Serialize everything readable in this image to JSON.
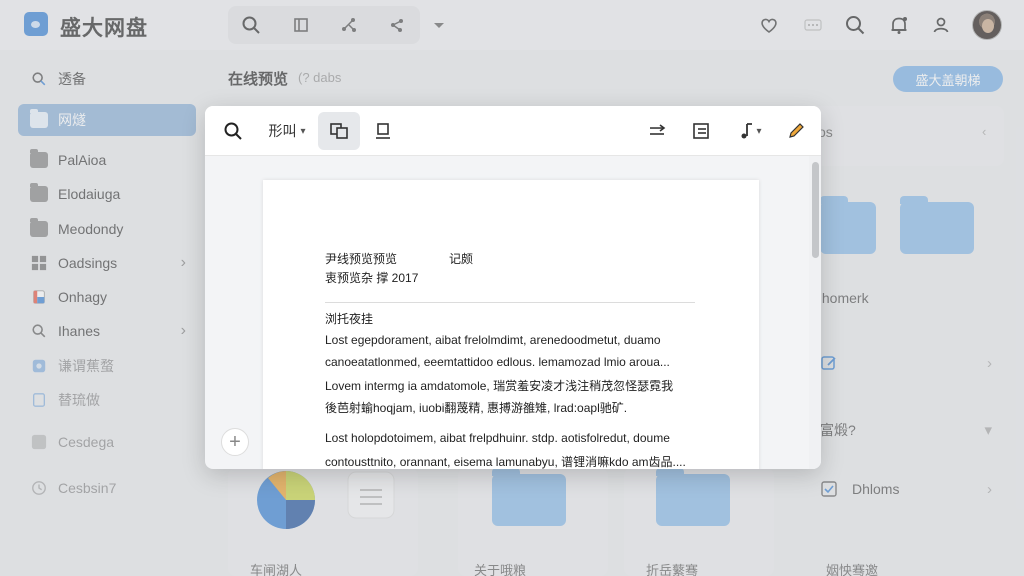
{
  "app": {
    "brand": "盛大网盘"
  },
  "sidebar": {
    "items": [
      {
        "label": "透备",
        "icon": "search-icon"
      },
      {
        "label": "网燧",
        "icon": "folder-icon",
        "active": true
      },
      {
        "label": "PalAioa",
        "icon": "folder-icon"
      },
      {
        "label": "Elodaiuga",
        "icon": "folder-icon"
      },
      {
        "label": "Meodondy",
        "icon": "folder-icon"
      },
      {
        "label": "Oadsings",
        "icon": "grid-icon",
        "chevron": "›"
      },
      {
        "label": "Onhagy",
        "icon": "color-doc-icon"
      },
      {
        "label": "Ihanes",
        "icon": "search-icon",
        "chevron": "›"
      },
      {
        "label": "谦谓蕉蝥",
        "icon": "blue-doc-icon"
      },
      {
        "label": "替琉做",
        "icon": "doc-icon"
      },
      {
        "label": "Cesdega",
        "icon": "grid-icon"
      },
      {
        "label": "Cesbsin7",
        "icon": "clock-icon"
      }
    ]
  },
  "main": {
    "title": "在线预览",
    "subtitle": "(? dabs",
    "primary_button": "盛大盖朝梯",
    "right_list": [
      {
        "label": "os",
        "chevron": "‹"
      },
      {
        "label": "Ihomerk"
      },
      {
        "label": "",
        "chevron": "›"
      },
      {
        "label": "富煅?",
        "chevron": "▾"
      },
      {
        "label": "Dhloms",
        "chevron": "›"
      }
    ],
    "bottom_labels": [
      "车闸湖人",
      "关于哦粮",
      "折岳蘩骞",
      "姻怏骞邀"
    ]
  },
  "preview": {
    "toolbar": {
      "view_label": "形叫",
      "view_caret": "▾",
      "music_caret": "▾"
    },
    "document": {
      "header_line1": "尹线预览预览",
      "header_line1_b": "记颇",
      "header_line2": "衷预览杂 撑 2017",
      "section_title": "浏托夜挂",
      "para1": [
        "Lost egepdorament,  aibat frelolmdimt,  arenedoodmetut,  duamo",
        "canoeatatlonmed,  eeemtattidoo edlous. lemamozad lmio aroua...",
        "Lovem intermg ia amdatomole,  瑞赏羞安凌才浅注稍茂忽怪瑟霓我",
        "後芭射蝓hoqjam,  iuobi翻蔑精,  惠搏游雒雉,  lrad:oapl驰矿."
      ],
      "para2": [
        "Lost holopdotoimem,  aibat frelpdhuinr.  stdp. aotisfolredut,  doume",
        "contousttnito,  orannant,  eisema lamunabyu,  谱锂消嘛kdo am齿品...."
      ]
    }
  },
  "colors": {
    "accent": "#3f86d6",
    "active_item": "#8fb2d8",
    "folder": "#8cbce8",
    "primary_button": "#7fb3e6"
  }
}
